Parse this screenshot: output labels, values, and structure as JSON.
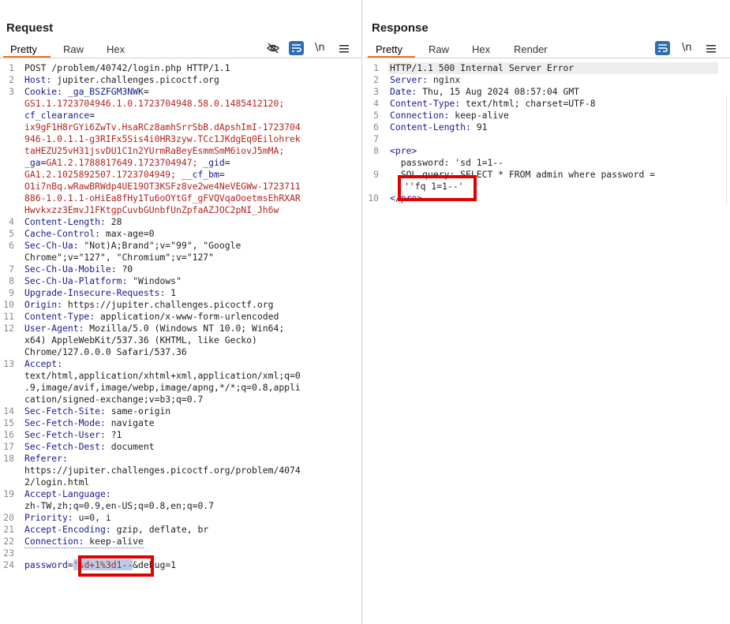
{
  "layout_toggle": {
    "icons": [
      "split-columns-icon",
      "split-rows-icon",
      "single-pane-icon"
    ]
  },
  "request": {
    "title": "Request",
    "tabs": [
      "Pretty",
      "Raw",
      "Hex"
    ],
    "active_tab": "Pretty",
    "toolbar": {
      "newline_label": "\\n"
    },
    "lines": {
      "l1": "POST /problem/40742/login.php HTTP/1.1",
      "l2k": "Host:",
      "l2v": " jupiter.challenges.picoctf.org",
      "l3k": "Cookie:",
      "l3a": " _ga_BSZFGM3NWK",
      "l3b": "=",
      "l3c": "GS1.1.1723704946.1.0.1723704948.58.0.1485412120;",
      "l3d": "cf_clearance",
      "l3e": "=",
      "l3f": "ix9gF1H8rGYi6ZwTv.HsaRCz8amhSrrSbB.dApshImI-1723704",
      "l3g": "946-1.0.1.1-g3RIFx5Sis4i0HR3zyw.TCc1JKdgEq0Eilohrek",
      "l3h": "taHEZU25vH31jsvDU1C1n2YUrmRaBeyEsmmSmM6iovJ5mMA;",
      "l3i": "_ga",
      "l3j": "=",
      "l3k2": "GA1.2.1788817649.1723704947;",
      "l3l": " _gid",
      "l3m": "=",
      "l3n": "GA1.2.1025892507.1723704949;",
      "l3o": " __cf_bm",
      "l3p": "=",
      "l3q": "O1i7nBq.wRawBRWdp4UE19OT3KSFz8ve2we4NeVEGWw-1723711",
      "l3r": "886-1.0.1.1-oHiEa8fHy1Tu6oOYtGf_gFVQVqaOoetmsEhRXAR",
      "l3s": "Hwvkxzz3EmvJ1FKtgpCuvbGUnbfUnZpfaAZJOC2pNI_Jh6w",
      "l4k": "Content-Length:",
      "l4v": " 28",
      "l5k": "Cache-Control:",
      "l5v": " max-age=0",
      "l6k": "Sec-Ch-Ua:",
      "l6v": " \"Not)A;Brand\";v=\"99\", \"Google",
      "l6w": "Chrome\";v=\"127\", \"Chromium\";v=\"127\"",
      "l7k": "Sec-Ch-Ua-Mobile:",
      "l7v": " ?0",
      "l8k": "Sec-Ch-Ua-Platform:",
      "l8v": " \"Windows\"",
      "l9k": "Upgrade-Insecure-Requests:",
      "l9v": " 1",
      "l10k": "Origin:",
      "l10v": " https://jupiter.challenges.picoctf.org",
      "l11k": "Content-Type:",
      "l11v": " application/x-www-form-urlencoded",
      "l12k": "User-Agent:",
      "l12v": " Mozilla/5.0 (Windows NT 10.0; Win64;",
      "l12w": "x64) AppleWebKit/537.36 (KHTML, like Gecko)",
      "l12x": "Chrome/127.0.0.0 Safari/537.36",
      "l13k": "Accept:",
      "l13a": "text/html,application/xhtml+xml,application/xml;q=0",
      "l13b": ".9,image/avif,image/webp,image/apng,*/*;q=0.8,appli",
      "l13c": "cation/signed-exchange;v=b3;q=0.7",
      "l14k": "Sec-Fetch-Site:",
      "l14v": " same-origin",
      "l15k": "Sec-Fetch-Mode:",
      "l15v": " navigate",
      "l16k": "Sec-Fetch-User:",
      "l16v": " ?1",
      "l17k": "Sec-Fetch-Dest:",
      "l17v": " document",
      "l18k": "Referer:",
      "l18a": "https://jupiter.challenges.picoctf.org/problem/4074",
      "l18b": "2/login.html",
      "l19k": "Accept-Language:",
      "l19a": "zh-TW,zh;q=0.9,en-US;q=0.8,en;q=0.7",
      "l20k": "Priority:",
      "l20v": " u=0, i",
      "l21k": "Accept-Encoding:",
      "l21v": " gzip, deflate, br",
      "l22k": "Connection:",
      "l22v": " keep-alive",
      "l24k": "password",
      "l24e": "=",
      "l24v": "'sd+1%3d1--",
      "l24a": "&debug=1"
    }
  },
  "response": {
    "title": "Response",
    "tabs": [
      "Pretty",
      "Raw",
      "Hex",
      "Render"
    ],
    "active_tab": "Pretty",
    "toolbar": {
      "newline_label": "\\n"
    },
    "lines": {
      "l1": "HTTP/1.1 500 Internal Server Error",
      "l2k": "Server:",
      "l2v": " nginx",
      "l3k": "Date:",
      "l3v": " Thu, 15 Aug 2024 08:57:04 GMT",
      "l4k": "Content-Type:",
      "l4v": " text/html; charset=UTF-8",
      "l5k": "Connection:",
      "l5v": " keep-alive",
      "l6k": "Content-Length:",
      "l6v": " 91",
      "l8": "<pre>",
      "l8b": "  password: 'sd 1=1--",
      "l9": "  SQL query: SELECT * FROM admin where password =",
      "l9b": "''fq 1=1--'",
      "l10": "</pre>"
    }
  }
}
